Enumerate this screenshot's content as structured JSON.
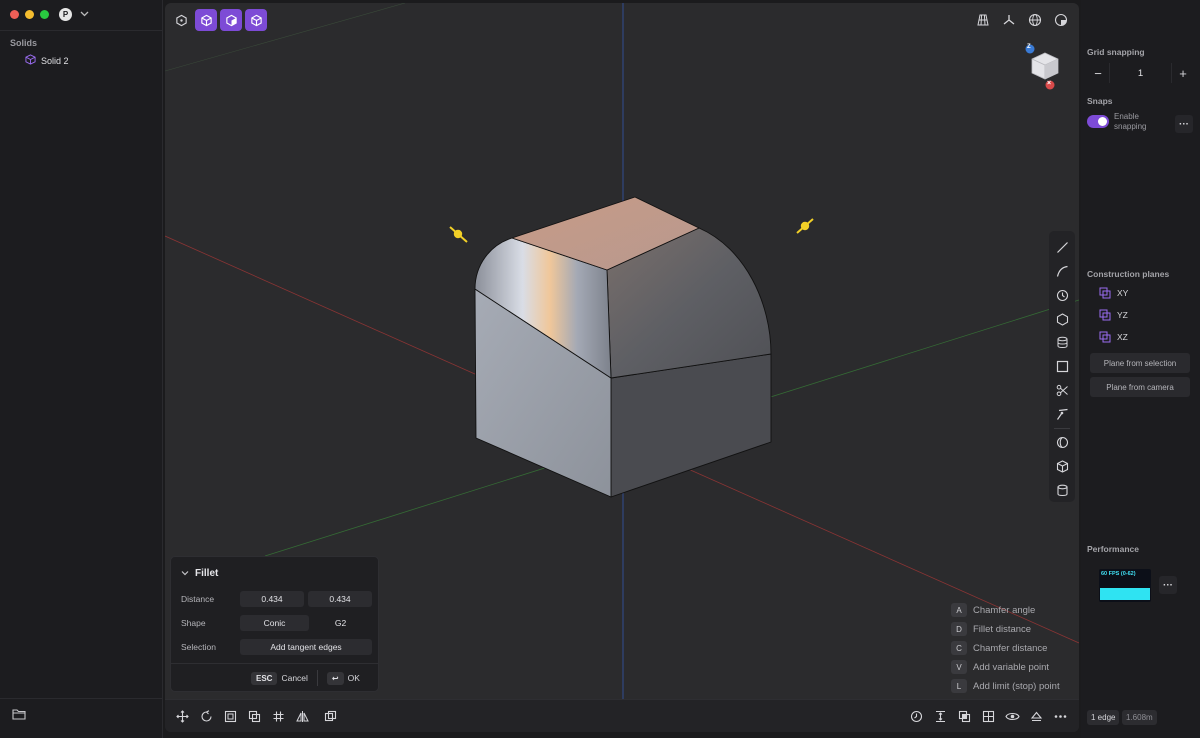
{
  "window": {
    "app_badge": "P"
  },
  "left_sidebar": {
    "section_title": "Solids",
    "items": [
      {
        "label": "Solid 2"
      }
    ]
  },
  "viewcube": {
    "axis_label": "Z",
    "close_label": "×"
  },
  "fillet_panel": {
    "title": "Fillet",
    "distance_label": "Distance",
    "distance_values": [
      "0.434",
      "0.434"
    ],
    "shape_label": "Shape",
    "shape_options": [
      "Conic",
      "G2"
    ],
    "selection_label": "Selection",
    "selection_button": "Add tangent edges",
    "cancel_key": "ESC",
    "cancel_label": "Cancel",
    "ok_key": "↩",
    "ok_label": "OK"
  },
  "shortcut_hints": [
    {
      "key": "A",
      "label": "Chamfer angle"
    },
    {
      "key": "D",
      "label": "Fillet distance"
    },
    {
      "key": "C",
      "label": "Chamfer distance"
    },
    {
      "key": "V",
      "label": "Add variable point"
    },
    {
      "key": "L",
      "label": "Add limit (stop) point"
    }
  ],
  "right_sidebar": {
    "grid_snapping_title": "Grid snapping",
    "grid_snapping_value": "1",
    "minus_label": "−",
    "plus_label": "+",
    "snaps_title": "Snaps",
    "enable_snapping_label": "Enable snapping",
    "enable_snapping_on": true,
    "more_label": "···",
    "construction_planes_title": "Construction planes",
    "planes": [
      {
        "label": "XY"
      },
      {
        "label": "YZ"
      },
      {
        "label": "XZ"
      }
    ],
    "plane_from_selection": "Plane from selection",
    "plane_from_camera": "Plane from camera",
    "performance_title": "Performance",
    "fps_label": "60 FPS (0-62)",
    "selection_count": "1 edge",
    "measurement": "1.608m"
  },
  "colors": {
    "accent": "#7d4bd6",
    "viewport_bg": "#2b2b2d",
    "axis_x": "#b03a3a",
    "axis_y": "#3d7a3d",
    "axis_z": "#3b5fbf",
    "handle": "#f2d027",
    "perf_bar": "#2fe3f2"
  }
}
